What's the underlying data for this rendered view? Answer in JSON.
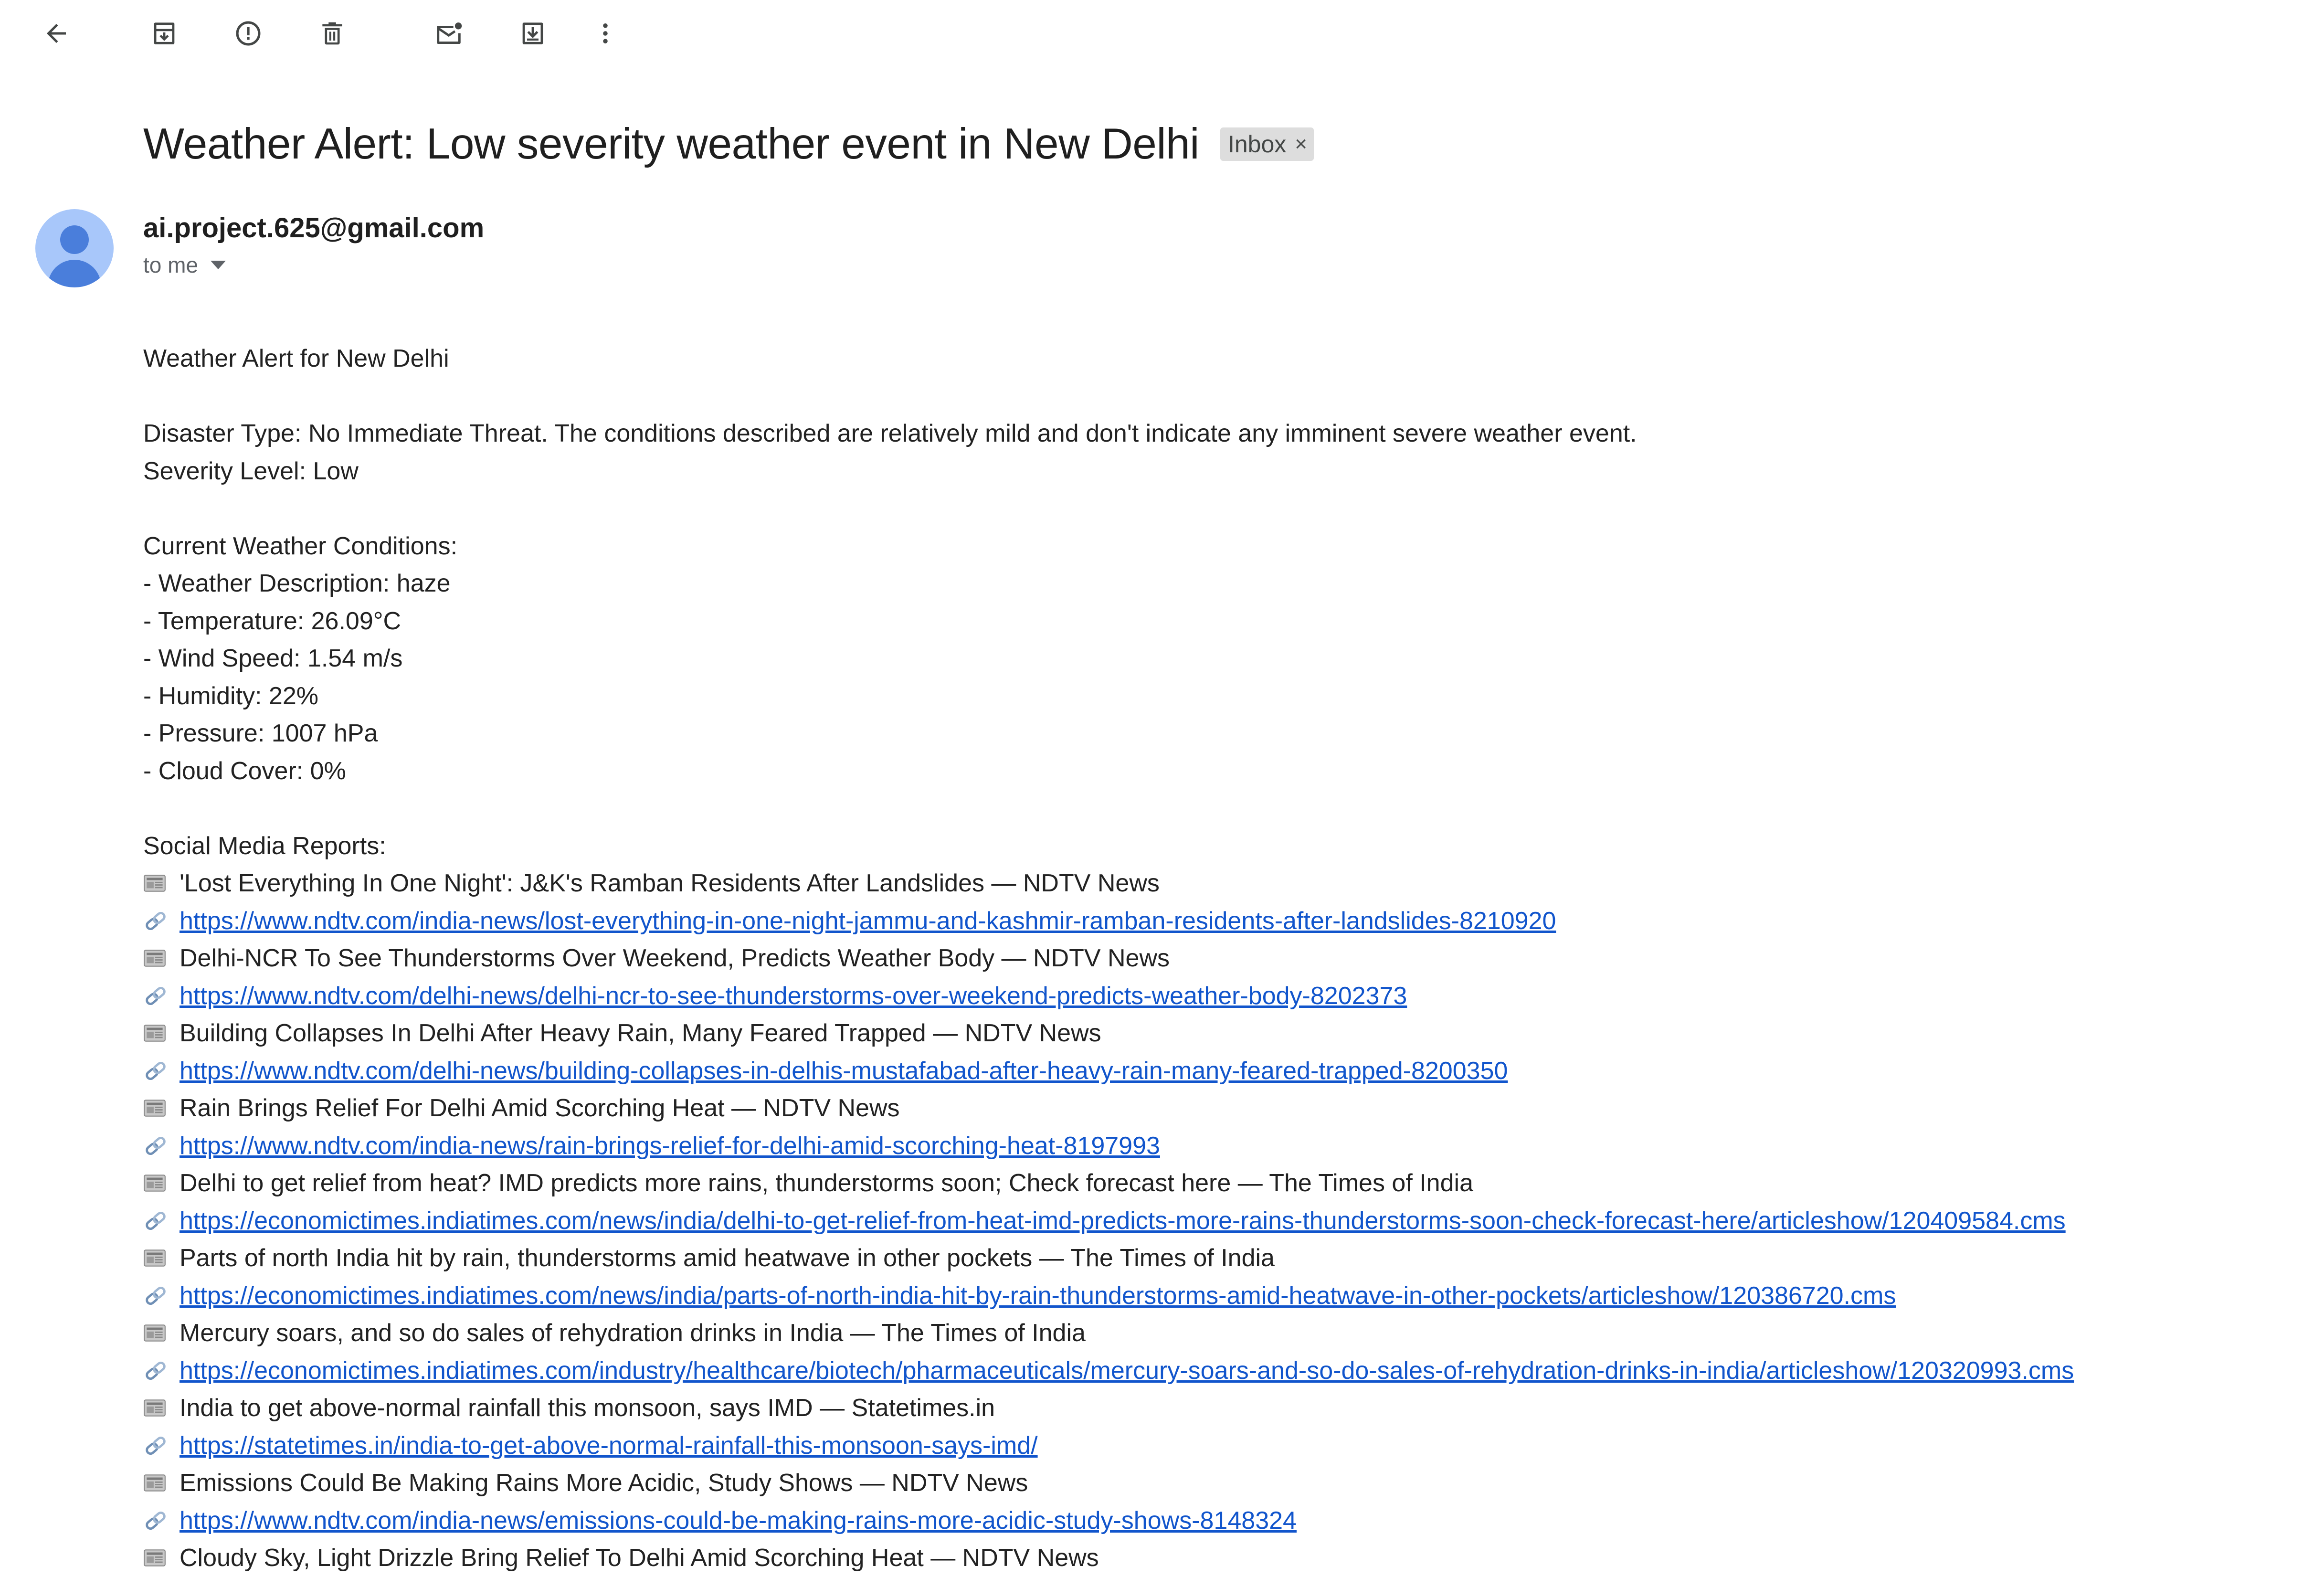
{
  "toolbar": {
    "back": "back-arrow-icon",
    "archive": "archive-icon",
    "spam": "report-spam-icon",
    "delete": "delete-icon",
    "mark_unread": "mark-unread-icon",
    "move": "move-to-icon",
    "more": "more-options-icon"
  },
  "subject": "Weather Alert: Low severity weather event in New Delhi",
  "label": {
    "text": "Inbox",
    "remove": "×"
  },
  "sender": {
    "email": "ai.project.625@gmail.com",
    "to": "to me"
  },
  "body": {
    "greeting": "Weather Alert for New Delhi",
    "disaster_type": "Disaster Type: No Immediate Threat.  The conditions described are relatively mild and don't indicate any imminent severe weather event.",
    "severity": "Severity Level: Low",
    "conditions_header": "Current Weather Conditions:",
    "conditions": [
      "- Weather Description: haze",
      "- Temperature: 26.09°C",
      "- Wind Speed: 1.54 m/s",
      "- Humidity: 22%",
      "- Pressure: 1007 hPa",
      "- Cloud Cover: 0%"
    ],
    "social_header": "Social Media Reports:",
    "news": [
      {
        "title": "'Lost Everything In One Night': J&K's Ramban Residents After Landslides — NDTV News",
        "url": "https://www.ndtv.com/india-news/lost-everything-in-one-night-jammu-and-kashmir-ramban-residents-after-landslides-8210920"
      },
      {
        "title": "Delhi-NCR To See Thunderstorms Over Weekend, Predicts Weather Body — NDTV News",
        "url": "https://www.ndtv.com/delhi-news/delhi-ncr-to-see-thunderstorms-over-weekend-predicts-weather-body-8202373"
      },
      {
        "title": "Building Collapses In Delhi After Heavy Rain, Many Feared Trapped — NDTV News",
        "url": "https://www.ndtv.com/delhi-news/building-collapses-in-delhis-mustafabad-after-heavy-rain-many-feared-trapped-8200350"
      },
      {
        "title": "Rain Brings Relief For Delhi Amid Scorching Heat — NDTV News",
        "url": "https://www.ndtv.com/india-news/rain-brings-relief-for-delhi-amid-scorching-heat-8197993"
      },
      {
        "title": "Delhi to get relief from heat? IMD predicts more rains, thunderstorms soon; Check forecast here — The Times of India",
        "url": "https://economictimes.indiatimes.com/news/india/delhi-to-get-relief-from-heat-imd-predicts-more-rains-thunderstorms-soon-check-forecast-here/articleshow/120409584.cms"
      },
      {
        "title": "Parts of north India hit by rain, thunderstorms amid heatwave in other pockets — The Times of India",
        "url": "https://economictimes.indiatimes.com/news/india/parts-of-north-india-hit-by-rain-thunderstorms-amid-heatwave-in-other-pockets/articleshow/120386720.cms"
      },
      {
        "title": "Mercury soars, and so do sales of rehydration drinks in India — The Times of India",
        "url": "https://economictimes.indiatimes.com/industry/healthcare/biotech/pharmaceuticals/mercury-soars-and-so-do-sales-of-rehydration-drinks-in-india/articleshow/120320993.cms"
      },
      {
        "title": "India to get above-normal rainfall this monsoon, says IMD — Statetimes.in",
        "url": "https://statetimes.in/india-to-get-above-normal-rainfall-this-monsoon-says-imd/"
      },
      {
        "title": "Emissions Could Be Making Rains More Acidic, Study Shows — NDTV News",
        "url": "https://www.ndtv.com/india-news/emissions-could-be-making-rains-more-acidic-study-shows-8148324"
      },
      {
        "title": "Cloudy Sky, Light Drizzle Bring Relief To Delhi Amid Scorching Heat — NDTV News",
        "url": ""
      }
    ]
  },
  "colors": {
    "link": "#1155cc",
    "text": "#222222",
    "avatar_bg": "#a8c7fa",
    "avatar_fg": "#4a7edb",
    "chip_bg": "#dddddd"
  }
}
